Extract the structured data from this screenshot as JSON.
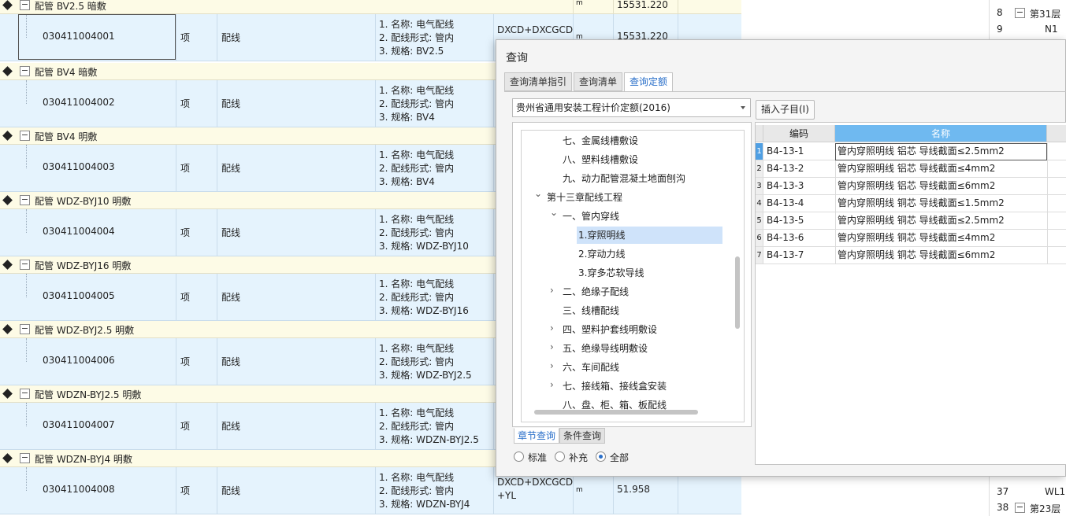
{
  "main_grid": {
    "groups": [
      {
        "name": "配管 BV2.5 暗敷",
        "unit": "m",
        "qty": "15531.220"
      },
      {
        "name": "配管 BV4 暗敷"
      },
      {
        "name": "配管 BV4 明敷"
      },
      {
        "name": "配管 WDZ-BYJ10 明敷"
      },
      {
        "name": "配管 WDZ-BYJ16 明敷"
      },
      {
        "name": "配管 WDZ-BYJ2.5 明敷"
      },
      {
        "name": "配管 WDZN-BYJ2.5 明敷"
      },
      {
        "name": "配管 WDZN-BYJ4 明敷"
      }
    ],
    "items": [
      {
        "code": "030411004001",
        "unit": "项",
        "name": "配线",
        "features": [
          "1. 名称: 电气配线",
          "2. 配线形式: 管内",
          "3. 规格: BV2.5"
        ],
        "quota": [
          "DXCD+DXCGCD"
        ],
        "qty_unit": "m",
        "qty": "15531.220"
      },
      {
        "code": "030411004002",
        "unit": "项",
        "name": "配线",
        "features": [
          "1. 名称: 电气配线",
          "2. 配线形式: 管内",
          "3. 规格: BV4"
        ],
        "quota": [],
        "qty_unit": "",
        "qty": ""
      },
      {
        "code": "030411004003",
        "unit": "项",
        "name": "配线",
        "features": [
          "1. 名称: 电气配线",
          "2. 配线形式: 管内",
          "3. 规格: BV4"
        ],
        "quota": [],
        "qty_unit": "",
        "qty": ""
      },
      {
        "code": "030411004004",
        "unit": "项",
        "name": "配线",
        "features": [
          "1. 名称: 电气配线",
          "2. 配线形式: 管内",
          "3. 规格: WDZ-BYJ10"
        ],
        "quota": [],
        "qty_unit": "",
        "qty": ""
      },
      {
        "code": "030411004005",
        "unit": "项",
        "name": "配线",
        "features": [
          "1. 名称: 电气配线",
          "2. 配线形式: 管内",
          "3. 规格: WDZ-BYJ16"
        ],
        "quota": [],
        "qty_unit": "",
        "qty": ""
      },
      {
        "code": "030411004006",
        "unit": "项",
        "name": "配线",
        "features": [
          "1. 名称: 电气配线",
          "2. 配线形式: 管内",
          "3. 规格: WDZ-BYJ2.5"
        ],
        "quota": [],
        "qty_unit": "",
        "qty": ""
      },
      {
        "code": "030411004007",
        "unit": "项",
        "name": "配线",
        "features": [
          "1. 名称: 电气配线",
          "2. 配线形式: 管内",
          "3. 规格: WDZN-BYJ2.5"
        ],
        "quota": [],
        "qty_unit": "",
        "qty": ""
      },
      {
        "code": "030411004008",
        "unit": "项",
        "name": "配线",
        "features": [
          "1. 名称: 电气配线",
          "2. 配线形式: 管内",
          "3. 规格: WDZN-BYJ4"
        ],
        "quota": [
          "DXCD+DXCGCD",
          "+YL"
        ],
        "qty_unit": "m",
        "qty": "51.958"
      }
    ]
  },
  "side_tree": {
    "top": [
      {
        "num": "8",
        "label": "第31层",
        "toggle": "−"
      },
      {
        "num": "9",
        "label": "N1"
      }
    ],
    "bottom": [
      {
        "num": "37",
        "label": "WL1"
      },
      {
        "num": "38",
        "label": "第23层",
        "toggle": "−"
      }
    ]
  },
  "dialog": {
    "title": "查询",
    "tabs": [
      "查询清单指引",
      "查询清单",
      "查询定额"
    ],
    "active_tab": "查询定额",
    "quota_library": "贵州省通用安装工程计价定额(2016)",
    "insert_button": "插入子目(I)",
    "tree": [
      {
        "label": "七、金属线槽敷设",
        "indent": 3
      },
      {
        "label": "八、塑料线槽敷设",
        "indent": 3
      },
      {
        "label": "九、动力配管混凝土地面刨沟",
        "indent": 3
      },
      {
        "label": "第十三章配线工程",
        "indent": 2,
        "chevron": "down"
      },
      {
        "label": "一、管内穿线",
        "indent": 3,
        "chevron": "down"
      },
      {
        "label": "1.穿照明线",
        "indent": 4,
        "selected": true
      },
      {
        "label": "2.穿动力线",
        "indent": 4
      },
      {
        "label": "3.穿多芯软导线",
        "indent": 4
      },
      {
        "label": "二、绝缘子配线",
        "indent": 3,
        "chevron": "right"
      },
      {
        "label": "三、线槽配线",
        "indent": 3
      },
      {
        "label": "四、塑料护套线明敷设",
        "indent": 3,
        "chevron": "right"
      },
      {
        "label": "五、绝缘导线明敷设",
        "indent": 3,
        "chevron": "right"
      },
      {
        "label": "六、车间配线",
        "indent": 3,
        "chevron": "right"
      },
      {
        "label": "七、接线箱、接线盒安装",
        "indent": 3,
        "chevron": "right"
      },
      {
        "label": "八、盘、柜、箱、板配线",
        "indent": 3
      }
    ],
    "bottom_tabs": [
      "章节查询",
      "条件查询"
    ],
    "radios": [
      {
        "label": "标准",
        "checked": false
      },
      {
        "label": "补充",
        "checked": false
      },
      {
        "label": "全部",
        "checked": true
      }
    ],
    "results": {
      "headers": [
        "编码",
        "名称"
      ],
      "rows": [
        {
          "n": "1",
          "code": "B4-13-1",
          "name": "管内穿照明线 铝芯 导线截面≤2.5mm2"
        },
        {
          "n": "2",
          "code": "B4-13-2",
          "name": "管内穿照明线 铝芯 导线截面≤4mm2"
        },
        {
          "n": "3",
          "code": "B4-13-3",
          "name": "管内穿照明线 铝芯 导线截面≤6mm2"
        },
        {
          "n": "4",
          "code": "B4-13-4",
          "name": "管内穿照明线 铜芯 导线截面≤1.5mm2"
        },
        {
          "n": "5",
          "code": "B4-13-5",
          "name": "管内穿照明线 铜芯 导线截面≤2.5mm2"
        },
        {
          "n": "6",
          "code": "B4-13-6",
          "name": "管内穿照明线 铜芯 导线截面≤4mm2"
        },
        {
          "n": "7",
          "code": "B4-13-7",
          "name": "管内穿照明线 铜芯 导线截面≤6mm2"
        }
      ]
    }
  },
  "colors": {
    "accent": "#2a6fc9",
    "group_row_bg": "#fdfbe6",
    "item_row_bg": "#e5f3fd",
    "selected_tree_bg": "#cfe3fa",
    "header_highlight": "#6fb9f0"
  }
}
